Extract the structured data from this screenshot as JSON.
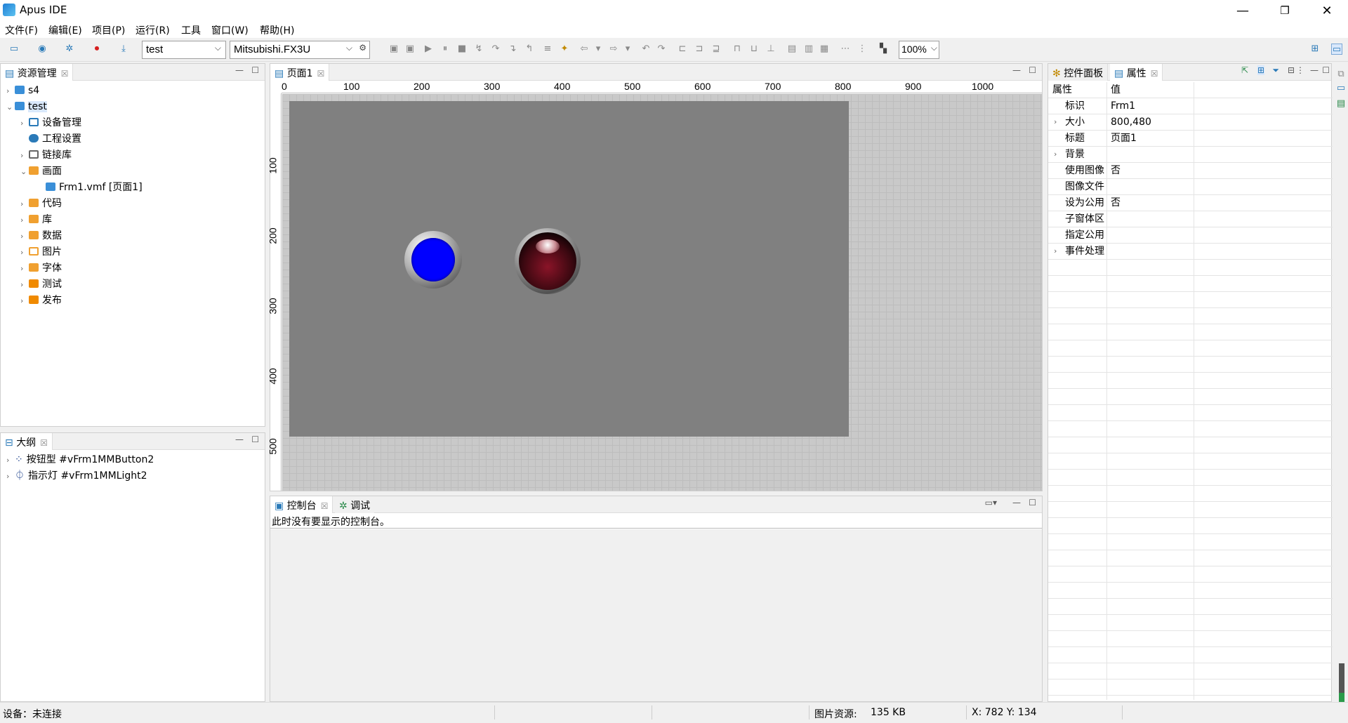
{
  "app": {
    "title": "Apus IDE"
  },
  "menu": [
    "文件(F)",
    "编辑(E)",
    "项目(P)",
    "运行(R)",
    "工具",
    "窗口(W)",
    "帮助(H)"
  ],
  "toolbar": {
    "project_select": "test",
    "device_select": "Mitsubishi.FX3U",
    "zoom_select": "100%"
  },
  "resources": {
    "tab": "资源管理",
    "items": [
      {
        "label": "s4"
      },
      {
        "label": "test"
      },
      {
        "label": "设备管理"
      },
      {
        "label": "工程设置"
      },
      {
        "label": "链接库"
      },
      {
        "label": "画面"
      },
      {
        "label": "Frm1.vmf [页面1]"
      },
      {
        "label": "代码"
      },
      {
        "label": "库"
      },
      {
        "label": "数据"
      },
      {
        "label": "图片"
      },
      {
        "label": "字体"
      },
      {
        "label": "测试"
      },
      {
        "label": "发布"
      }
    ]
  },
  "outline": {
    "tab": "大纲",
    "items": [
      {
        "label": "按钮型 #vFrm1MMButton2"
      },
      {
        "label": "指示灯 #vFrm1MMLight2"
      }
    ]
  },
  "editor": {
    "tab": "页面1",
    "ruler_h": [
      "0",
      "100",
      "200",
      "300",
      "400",
      "500",
      "600",
      "700",
      "800",
      "900",
      "1000"
    ],
    "ruler_v": [
      "100",
      "200",
      "300",
      "400",
      "500"
    ]
  },
  "console": {
    "tab_console": "控制台",
    "tab_debug": "调试",
    "message": "此时没有要显示的控制台。"
  },
  "properties": {
    "tab_widgets": "控件面板",
    "tab_props": "属性",
    "col_name": "属性",
    "col_value": "值",
    "rows": [
      {
        "name": "标识",
        "value": "Frm1"
      },
      {
        "name": "大小",
        "value": "800,480"
      },
      {
        "name": "标题",
        "value": "页面1"
      },
      {
        "name": "背景",
        "value": ""
      },
      {
        "name": "使用图像",
        "value": "否"
      },
      {
        "name": "图像文件",
        "value": ""
      },
      {
        "name": "设为公用",
        "value": "否"
      },
      {
        "name": "子窗体区",
        "value": ""
      },
      {
        "name": "指定公用",
        "value": ""
      },
      {
        "name": "事件处理",
        "value": ""
      }
    ]
  },
  "status": {
    "device": "设备：未连接",
    "image_res_label": "图片资源:",
    "image_res_value": "135 KB",
    "coords": "X: 782  Y: 134"
  },
  "colors": {
    "canvas": "#808080",
    "button": "#0000ff",
    "light": "#6a0d1c"
  }
}
